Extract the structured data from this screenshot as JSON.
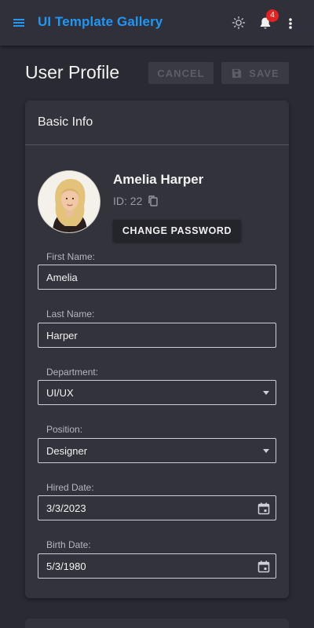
{
  "app": {
    "title": "UI Template Gallery",
    "notification_count": "4"
  },
  "page": {
    "title": "User Profile",
    "cancel_label": "CANCEL",
    "save_label": "SAVE"
  },
  "card": {
    "title": "Basic Info",
    "user_name": "Amelia Harper",
    "user_id": "ID: 22",
    "change_password_label": "CHANGE PASSWORD"
  },
  "fields": {
    "first_name": {
      "label": "First Name:",
      "value": "Amelia"
    },
    "last_name": {
      "label": "Last Name:",
      "value": "Harper"
    },
    "department": {
      "label": "Department:",
      "value": "UI/UX"
    },
    "position": {
      "label": "Position:",
      "value": "Designer"
    },
    "hired_date": {
      "label": "Hired Date:",
      "value": "3/3/2023"
    },
    "birth_date": {
      "label": "Birth Date:",
      "value": "5/3/1980"
    }
  },
  "icons": {
    "menu": "menu-icon",
    "theme": "brightness-icon",
    "notifications": "bell-icon",
    "more": "more-vertical-icon",
    "save": "floppy-disk-icon",
    "copy": "copy-icon",
    "calendar": "calendar-icon",
    "dropdown": "chevron-down-icon"
  },
  "colors": {
    "accent": "#2196f3",
    "badge": "#e52222",
    "background": "#2a2a33",
    "card": "#33333b"
  }
}
